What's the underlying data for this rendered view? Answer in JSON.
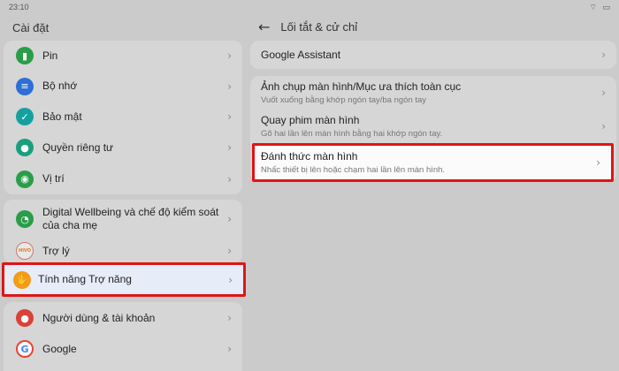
{
  "status": {
    "time": "23:10",
    "icons": "⌔ ▭"
  },
  "left": {
    "title": "Cài đặt",
    "group1": [
      {
        "label": "Pin",
        "icon": "battery-icon",
        "color": "#2a9d48",
        "glyph": "▮"
      },
      {
        "label": "Bộ nhớ",
        "icon": "storage-icon",
        "color": "#2c6fd6",
        "glyph": "≡"
      },
      {
        "label": "Bảo mật",
        "icon": "shield-icon",
        "color": "#15a0a0",
        "glyph": "✓"
      },
      {
        "label": "Quyền riêng tư",
        "icon": "privacy-icon",
        "color": "#18a07e",
        "glyph": "●"
      },
      {
        "label": "Vị trí",
        "icon": "location-icon",
        "color": "#2a9d48",
        "glyph": "◉"
      }
    ],
    "group2": [
      {
        "label": "Digital Wellbeing và chế độ kiểm soát của cha mẹ",
        "icon": "wellbeing-icon",
        "color": "#2a9d48",
        "glyph": "◔"
      },
      {
        "label": "Trợ lý",
        "icon": "assistant-icon",
        "color": "#e8e8e8",
        "glyph": "HiVO"
      }
    ],
    "accessibility": {
      "label": "Tính năng Trợ năng",
      "icon": "hand-icon",
      "glyph": "✋"
    },
    "group3": [
      {
        "label": "Người dùng & tài khoản",
        "icon": "user-icon",
        "color": "#d9423a",
        "glyph": "●"
      },
      {
        "label": "Google",
        "icon": "google-icon",
        "color": "#ffffff",
        "glyph": "G"
      }
    ]
  },
  "right": {
    "title": "Lối tắt & cử chỉ",
    "google_assistant": "Google Assistant",
    "screenshot": {
      "title": "Ảnh chụp màn hình/Mục ưa thích toàn cục",
      "subtitle": "Vuốt xuống bằng khớp ngón tay/ba ngón tay"
    },
    "screen_record": {
      "title": "Quay phim màn hình",
      "subtitle": "Gõ hai lần lên màn hình bằng hai khớp ngón tay."
    },
    "wake_screen": {
      "title": "Đánh thức màn hình",
      "subtitle": "Nhấc thiết bị lên hoặc chạm hai lần lên màn hình."
    }
  },
  "chevron": "›",
  "back_glyph": "←",
  "accent": "#e01515"
}
